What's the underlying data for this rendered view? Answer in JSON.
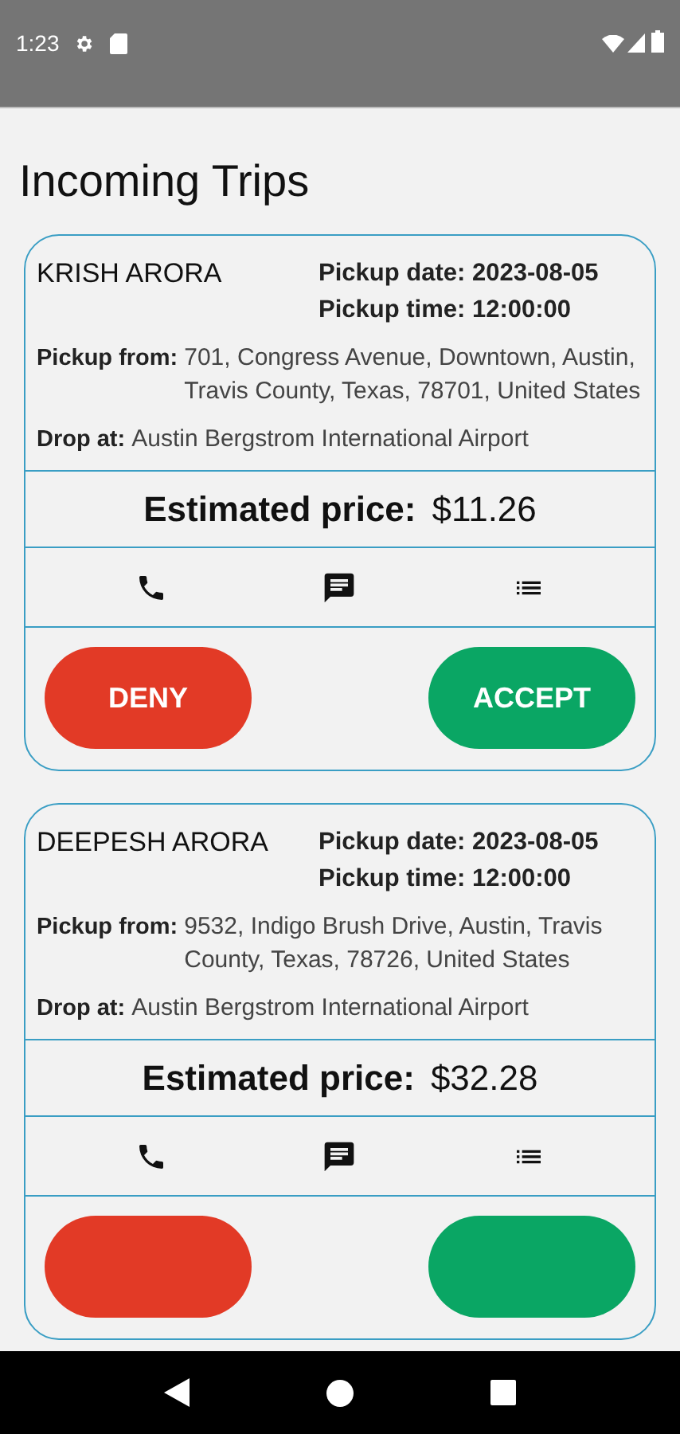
{
  "status_bar": {
    "time": "1:23"
  },
  "title": "Incoming Trips",
  "trips": [
    {
      "name": "KRISH ARORA",
      "date_label": "Pickup date:",
      "date": "2023-08-05",
      "time_label": "Pickup time:",
      "time": "12:00:00",
      "from_label": "Pickup from:",
      "from": "701, Congress Avenue, Downtown, Austin, Travis County, Texas, 78701, United States",
      "drop_label": "Drop at:",
      "drop": "Austin Bergstrom International Airport",
      "price_label": "Estimated price:",
      "price": "$11.26",
      "buttons": [
        {
          "kind": "deny",
          "label": "DENY"
        },
        {
          "kind": "accept",
          "label": "ACCEPT"
        }
      ]
    },
    {
      "name": "DEEPESH ARORA",
      "date_label": "Pickup date:",
      "date": "2023-08-05",
      "time_label": "Pickup time:",
      "time": "12:00:00",
      "from_label": "Pickup from:",
      "from": "9532, Indigo Brush Drive, Austin, Travis County, Texas, 78726, United States",
      "drop_label": "Drop at:",
      "drop": "Austin Bergstrom International Airport",
      "price_label": "Estimated price:",
      "price": "$32.28",
      "buttons": [
        {
          "kind": "deny"
        },
        {
          "kind": "accept"
        }
      ]
    }
  ]
}
